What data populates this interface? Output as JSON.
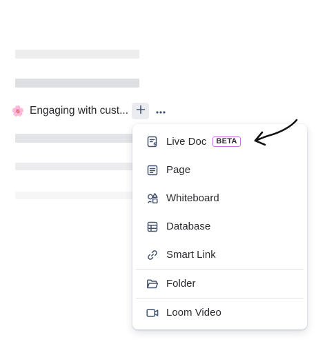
{
  "tree": {
    "emoji": "🌸",
    "title": "Engaging with cust..."
  },
  "menu": {
    "items": [
      {
        "label": "Live Doc",
        "badge": "BETA",
        "icon": "live-doc-icon"
      },
      {
        "label": "Page",
        "icon": "page-icon"
      },
      {
        "label": "Whiteboard",
        "icon": "whiteboard-icon"
      },
      {
        "label": "Database",
        "icon": "database-icon"
      },
      {
        "label": "Smart Link",
        "icon": "link-icon"
      },
      {
        "label": "Folder",
        "icon": "folder-icon"
      },
      {
        "label": "Loom Video",
        "icon": "video-icon"
      }
    ]
  },
  "colors": {
    "badge_border": "#c96ee8",
    "text": "#292a2e",
    "icon": "#44546f",
    "skeleton_dark": "#dcdfe4",
    "skeleton_light": "#f1f2f4"
  }
}
